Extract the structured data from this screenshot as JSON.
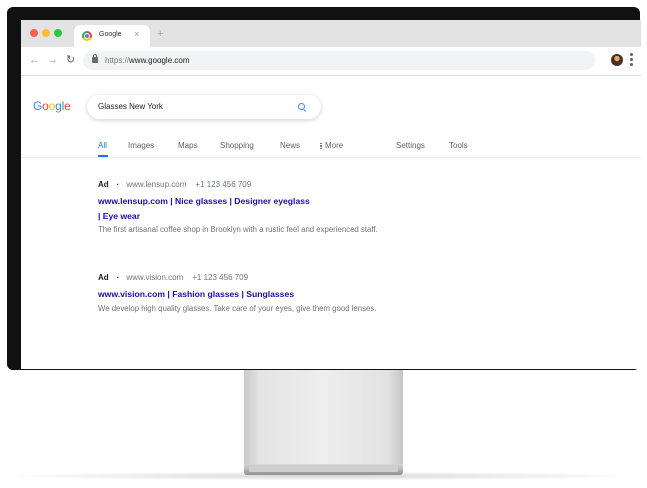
{
  "browser": {
    "tab_title": "Google",
    "tab_close": "×",
    "new_tab": "+",
    "url_scheme": "https://",
    "url_host": "www.google.com"
  },
  "google": {
    "logo_letters": [
      "G",
      "o",
      "o",
      "g",
      "l",
      "e"
    ],
    "search_query": "Glasses New York",
    "tabs": [
      "All",
      "Images",
      "Maps",
      "Shopping",
      "News",
      "More"
    ],
    "active_tab": "All",
    "settings_label": "Settings",
    "tools_label": "Tools"
  },
  "results": [
    {
      "badge": "Ad",
      "url": "www.lensup.com",
      "phone": "+1 123 456 709",
      "title_line1": "www.lensup.com | Nice glasses | Designer eyeglass",
      "title_line2": "| Eye wear",
      "description": "The first artisanal coffee shop in Brooklyn with a rustic feel and experienced staff."
    },
    {
      "badge": "Ad",
      "url": "www.vision.com",
      "phone": "+1 123 456 709",
      "title_line1": "www.vision.com | Fashion glasses | Sunglasses",
      "title_line2": "",
      "description": "We develop high quality glasses. Take care of your eyes, give them good lenses."
    }
  ],
  "colors": {
    "link_blue": "#1a0dab",
    "active_tab_blue": "#1a73e8",
    "google_blue": "#4285f4",
    "google_red": "#ea4335",
    "google_yellow": "#fbbc05",
    "google_green": "#34a853"
  }
}
